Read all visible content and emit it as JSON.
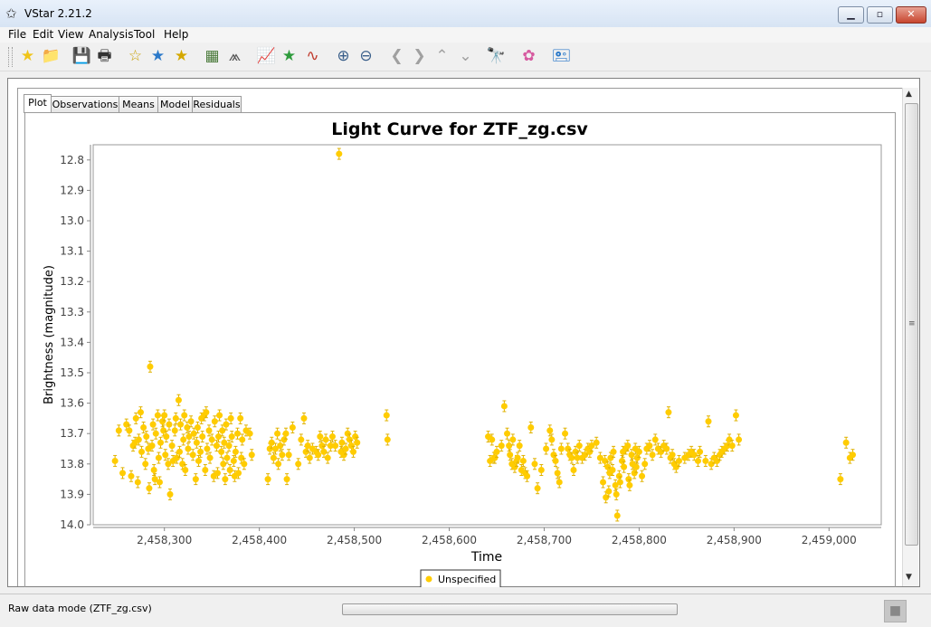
{
  "window": {
    "title": "VStar 2.21.2",
    "app_icon": "star-outline-icon"
  },
  "menu": [
    "File",
    "Edit",
    "View",
    "Analysis",
    "Tool",
    "Help"
  ],
  "toolbar": [
    {
      "name": "new-star-icon",
      "glyph": "★",
      "color": "#f0c419"
    },
    {
      "name": "open-folder-icon",
      "glyph": "📁",
      "color": "#d9a300"
    },
    {
      "name": "save-icon",
      "glyph": "💾",
      "color": "#333333"
    },
    {
      "name": "print-icon",
      "glyph": "🖶",
      "color": "#333333"
    },
    {
      "name": "star-info-icon",
      "glyph": "☆",
      "color": "#c8a000"
    },
    {
      "name": "star-plot-icon",
      "glyph": "★",
      "color": "#2b79c9"
    },
    {
      "name": "star-details-icon",
      "glyph": "★",
      "color": "#d4a800"
    },
    {
      "name": "raw-data-icon",
      "glyph": "▦",
      "color": "#4a7a3a"
    },
    {
      "name": "phase-plot-icon",
      "glyph": "⩕",
      "color": "#555555"
    },
    {
      "name": "chart-icon",
      "glyph": "📈",
      "color": "#8a3fb0"
    },
    {
      "name": "model-star-icon",
      "glyph": "★",
      "color": "#2e9b3c"
    },
    {
      "name": "waveform-icon",
      "glyph": "∿",
      "color": "#c0392b"
    },
    {
      "name": "zoom-in-icon",
      "glyph": "⊕",
      "color": "#3a5f8a"
    },
    {
      "name": "zoom-out-icon",
      "glyph": "⊖",
      "color": "#3a5f8a"
    },
    {
      "name": "pan-left-icon",
      "glyph": "❮",
      "color": "#a0a0a0"
    },
    {
      "name": "pan-right-icon",
      "glyph": "❯",
      "color": "#a0a0a0"
    },
    {
      "name": "pan-up-icon",
      "glyph": "⌃",
      "color": "#a0a0a0"
    },
    {
      "name": "pan-down-icon",
      "glyph": "⌄",
      "color": "#a0a0a0"
    },
    {
      "name": "telescope-icon",
      "glyph": "🔭",
      "color": "#222222"
    },
    {
      "name": "plugin-icon",
      "glyph": "✿",
      "color": "#d65aa0"
    },
    {
      "name": "info-icon",
      "glyph": "🖭",
      "color": "#2b79c9"
    }
  ],
  "tabs": [
    "Plot",
    "Observations",
    "Means",
    "Model",
    "Residuals"
  ],
  "active_tab": "Plot",
  "status": {
    "text": "Raw data mode (ZTF_zg.csv)"
  },
  "chart_data": {
    "type": "scatter",
    "title": "Light Curve for ZTF_zg.csv",
    "xlabel": "Time",
    "ylabel": "Brightness (magnitude)",
    "xlim": [
      2458225,
      2459055
    ],
    "ylim": [
      12.75,
      14.0
    ],
    "y_inverted": true,
    "x_ticks": [
      2458300,
      2458400,
      2458500,
      2458600,
      2458700,
      2458800,
      2458900,
      2459000
    ],
    "x_tick_labels": [
      "2,458,300",
      "2,458,400",
      "2,458,500",
      "2,458,600",
      "2,458,700",
      "2,458,800",
      "2,458,900",
      "2,459,000"
    ],
    "y_ticks": [
      12.8,
      12.9,
      13.0,
      13.1,
      13.2,
      13.3,
      13.4,
      13.5,
      13.6,
      13.7,
      13.8,
      13.9,
      14.0
    ],
    "legend": {
      "placement": "bottom-center"
    },
    "marker_color": "#ffcc00",
    "series": [
      {
        "name": "Unspecified",
        "points": [
          [
            2458248,
            13.79
          ],
          [
            2458252,
            13.69
          ],
          [
            2458256,
            13.83
          ],
          [
            2458260,
            13.67
          ],
          [
            2458263,
            13.69
          ],
          [
            2458265,
            13.84
          ],
          [
            2458267,
            13.74
          ],
          [
            2458269,
            13.73
          ],
          [
            2458270,
            13.65
          ],
          [
            2458272,
            13.86
          ],
          [
            2458273,
            13.72
          ],
          [
            2458275,
            13.63
          ],
          [
            2458276,
            13.76
          ],
          [
            2458278,
            13.68
          ],
          [
            2458280,
            13.8
          ],
          [
            2458281,
            13.71
          ],
          [
            2458283,
            13.75
          ],
          [
            2458284,
            13.88
          ],
          [
            2458285,
            13.48
          ],
          [
            2458287,
            13.74
          ],
          [
            2458288,
            13.67
          ],
          [
            2458289,
            13.82
          ],
          [
            2458290,
            13.85
          ],
          [
            2458291,
            13.7
          ],
          [
            2458293,
            13.64
          ],
          [
            2458294,
            13.78
          ],
          [
            2458295,
            13.86
          ],
          [
            2458296,
            13.73
          ],
          [
            2458298,
            13.66
          ],
          [
            2458299,
            13.69
          ],
          [
            2458300,
            13.64
          ],
          [
            2458301,
            13.77
          ],
          [
            2458302,
            13.71
          ],
          [
            2458304,
            13.8
          ],
          [
            2458305,
            13.67
          ],
          [
            2458306,
            13.9
          ],
          [
            2458308,
            13.74
          ],
          [
            2458309,
            13.79
          ],
          [
            2458311,
            13.69
          ],
          [
            2458312,
            13.65
          ],
          [
            2458313,
            13.78
          ],
          [
            2458315,
            13.59
          ],
          [
            2458316,
            13.76
          ],
          [
            2458317,
            13.67
          ],
          [
            2458319,
            13.8
          ],
          [
            2458320,
            13.72
          ],
          [
            2458321,
            13.64
          ],
          [
            2458322,
            13.82
          ],
          [
            2458324,
            13.68
          ],
          [
            2458325,
            13.75
          ],
          [
            2458326,
            13.71
          ],
          [
            2458328,
            13.66
          ],
          [
            2458330,
            13.77
          ],
          [
            2458331,
            13.7
          ],
          [
            2458333,
            13.85
          ],
          [
            2458334,
            13.73
          ],
          [
            2458335,
            13.68
          ],
          [
            2458336,
            13.79
          ],
          [
            2458338,
            13.76
          ],
          [
            2458339,
            13.65
          ],
          [
            2458340,
            13.71
          ],
          [
            2458342,
            13.64
          ],
          [
            2458343,
            13.82
          ],
          [
            2458344,
            13.63
          ],
          [
            2458345,
            13.75
          ],
          [
            2458347,
            13.69
          ],
          [
            2458348,
            13.78
          ],
          [
            2458350,
            13.72
          ],
          [
            2458352,
            13.84
          ],
          [
            2458353,
            13.66
          ],
          [
            2458355,
            13.74
          ],
          [
            2458356,
            13.83
          ],
          [
            2458357,
            13.71
          ],
          [
            2458358,
            13.64
          ],
          [
            2458360,
            13.76
          ],
          [
            2458361,
            13.69
          ],
          [
            2458362,
            13.8
          ],
          [
            2458363,
            13.73
          ],
          [
            2458364,
            13.85
          ],
          [
            2458365,
            13.67
          ],
          [
            2458366,
            13.78
          ],
          [
            2458368,
            13.74
          ],
          [
            2458369,
            13.82
          ],
          [
            2458370,
            13.65
          ],
          [
            2458371,
            13.71
          ],
          [
            2458373,
            13.79
          ],
          [
            2458374,
            13.84
          ],
          [
            2458375,
            13.76
          ],
          [
            2458377,
            13.7
          ],
          [
            2458378,
            13.83
          ],
          [
            2458380,
            13.65
          ],
          [
            2458381,
            13.78
          ],
          [
            2458382,
            13.72
          ],
          [
            2458384,
            13.8
          ],
          [
            2458386,
            13.69
          ],
          [
            2458390,
            13.7
          ],
          [
            2458392,
            13.77
          ],
          [
            2458409,
            13.85
          ],
          [
            2458411,
            13.75
          ],
          [
            2458413,
            13.73
          ],
          [
            2458415,
            13.78
          ],
          [
            2458417,
            13.75
          ],
          [
            2458419,
            13.7
          ],
          [
            2458420,
            13.8
          ],
          [
            2458422,
            13.74
          ],
          [
            2458424,
            13.77
          ],
          [
            2458426,
            13.72
          ],
          [
            2458428,
            13.7
          ],
          [
            2458429,
            13.85
          ],
          [
            2458431,
            13.77
          ],
          [
            2458435,
            13.68
          ],
          [
            2458441,
            13.8
          ],
          [
            2458444,
            13.72
          ],
          [
            2458447,
            13.65
          ],
          [
            2458449,
            13.76
          ],
          [
            2458451,
            13.74
          ],
          [
            2458453,
            13.78
          ],
          [
            2458456,
            13.75
          ],
          [
            2458460,
            13.76
          ],
          [
            2458462,
            13.77
          ],
          [
            2458464,
            13.71
          ],
          [
            2458466,
            13.74
          ],
          [
            2458468,
            13.76
          ],
          [
            2458470,
            13.72
          ],
          [
            2458472,
            13.78
          ],
          [
            2458475,
            13.74
          ],
          [
            2458477,
            13.71
          ],
          [
            2458480,
            13.74
          ],
          [
            2458484,
            12.78
          ],
          [
            2458486,
            13.76
          ],
          [
            2458487,
            13.73
          ],
          [
            2458489,
            13.77
          ],
          [
            2458491,
            13.75
          ],
          [
            2458493,
            13.7
          ],
          [
            2458495,
            13.72
          ],
          [
            2458497,
            13.74
          ],
          [
            2458499,
            13.76
          ],
          [
            2458501,
            13.71
          ],
          [
            2458503,
            13.73
          ],
          [
            2458534,
            13.64
          ],
          [
            2458535,
            13.72
          ],
          [
            2458641,
            13.71
          ],
          [
            2458643,
            13.79
          ],
          [
            2458645,
            13.72
          ],
          [
            2458647,
            13.78
          ],
          [
            2458648,
            13.78
          ],
          [
            2458650,
            13.76
          ],
          [
            2458655,
            13.74
          ],
          [
            2458658,
            13.61
          ],
          [
            2458661,
            13.7
          ],
          [
            2458663,
            13.74
          ],
          [
            2458664,
            13.77
          ],
          [
            2458666,
            13.8
          ],
          [
            2458667,
            13.72
          ],
          [
            2458669,
            13.81
          ],
          [
            2458671,
            13.79
          ],
          [
            2458672,
            13.78
          ],
          [
            2458674,
            13.74
          ],
          [
            2458676,
            13.82
          ],
          [
            2458678,
            13.79
          ],
          [
            2458680,
            13.83
          ],
          [
            2458682,
            13.84
          ],
          [
            2458686,
            13.68
          ],
          [
            2458690,
            13.8
          ],
          [
            2458693,
            13.88
          ],
          [
            2458697,
            13.82
          ],
          [
            2458702,
            13.75
          ],
          [
            2458706,
            13.69
          ],
          [
            2458708,
            13.72
          ],
          [
            2458710,
            13.77
          ],
          [
            2458712,
            13.79
          ],
          [
            2458714,
            13.83
          ],
          [
            2458716,
            13.86
          ],
          [
            2458718,
            13.75
          ],
          [
            2458722,
            13.7
          ],
          [
            2458725,
            13.75
          ],
          [
            2458727,
            13.77
          ],
          [
            2458729,
            13.78
          ],
          [
            2458731,
            13.82
          ],
          [
            2458733,
            13.76
          ],
          [
            2458735,
            13.78
          ],
          [
            2458737,
            13.74
          ],
          [
            2458740,
            13.78
          ],
          [
            2458743,
            13.77
          ],
          [
            2458746,
            13.75
          ],
          [
            2458748,
            13.76
          ],
          [
            2458750,
            13.74
          ],
          [
            2458755,
            13.73
          ],
          [
            2458759,
            13.78
          ],
          [
            2458762,
            13.86
          ],
          [
            2458764,
            13.79
          ],
          [
            2458765,
            13.91
          ],
          [
            2458767,
            13.81
          ],
          [
            2458768,
            13.89
          ],
          [
            2458769,
            13.83
          ],
          [
            2458770,
            13.78
          ],
          [
            2458772,
            13.82
          ],
          [
            2458773,
            13.76
          ],
          [
            2458775,
            13.87
          ],
          [
            2458776,
            13.9
          ],
          [
            2458777,
            13.97
          ],
          [
            2458779,
            13.84
          ],
          [
            2458780,
            13.86
          ],
          [
            2458782,
            13.79
          ],
          [
            2458783,
            13.76
          ],
          [
            2458784,
            13.81
          ],
          [
            2458786,
            13.75
          ],
          [
            2458788,
            13.74
          ],
          [
            2458789,
            13.85
          ],
          [
            2458790,
            13.87
          ],
          [
            2458792,
            13.77
          ],
          [
            2458793,
            13.8
          ],
          [
            2458795,
            13.83
          ],
          [
            2458796,
            13.75
          ],
          [
            2458797,
            13.81
          ],
          [
            2458798,
            13.78
          ],
          [
            2458800,
            13.76
          ],
          [
            2458803,
            13.84
          ],
          [
            2458806,
            13.8
          ],
          [
            2458808,
            13.75
          ],
          [
            2458811,
            13.74
          ],
          [
            2458814,
            13.77
          ],
          [
            2458817,
            13.72
          ],
          [
            2458820,
            13.75
          ],
          [
            2458823,
            13.76
          ],
          [
            2458826,
            13.74
          ],
          [
            2458829,
            13.75
          ],
          [
            2458831,
            13.63
          ],
          [
            2458833,
            13.78
          ],
          [
            2458835,
            13.77
          ],
          [
            2458837,
            13.8
          ],
          [
            2458839,
            13.81
          ],
          [
            2458842,
            13.79
          ],
          [
            2458848,
            13.78
          ],
          [
            2458852,
            13.77
          ],
          [
            2458855,
            13.76
          ],
          [
            2458858,
            13.77
          ],
          [
            2458862,
            13.79
          ],
          [
            2458864,
            13.76
          ],
          [
            2458870,
            13.79
          ],
          [
            2458873,
            13.66
          ],
          [
            2458876,
            13.8
          ],
          [
            2458879,
            13.78
          ],
          [
            2458882,
            13.79
          ],
          [
            2458885,
            13.77
          ],
          [
            2458887,
            13.76
          ],
          [
            2458890,
            13.75
          ],
          [
            2458893,
            13.74
          ],
          [
            2458895,
            13.72
          ],
          [
            2458898,
            13.74
          ],
          [
            2458902,
            13.64
          ],
          [
            2458905,
            13.72
          ],
          [
            2459012,
            13.85
          ],
          [
            2459018,
            13.73
          ],
          [
            2459022,
            13.78
          ],
          [
            2459025,
            13.77
          ]
        ]
      }
    ]
  }
}
